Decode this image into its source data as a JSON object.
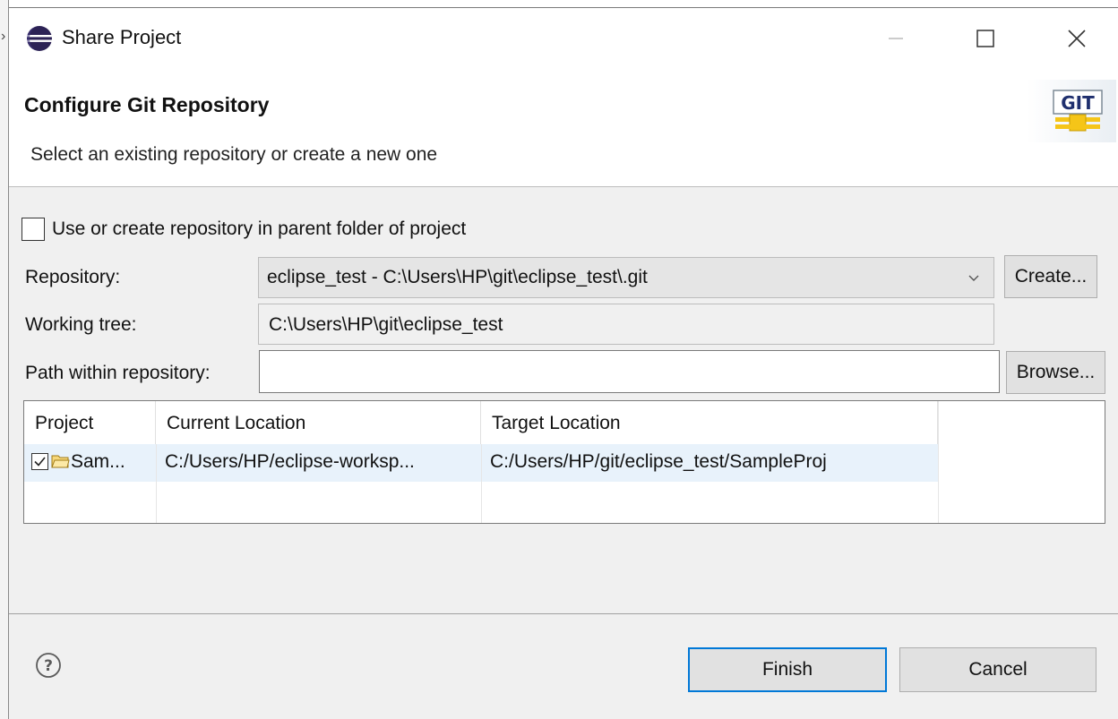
{
  "window": {
    "title": "Share Project"
  },
  "banner": {
    "title": "Configure Git Repository",
    "description": "Select an existing repository or create a new one",
    "logo_text": "GIT"
  },
  "form": {
    "parent_folder_label": "Use or create repository in parent folder of project",
    "parent_folder_checked": false,
    "repository_label": "Repository:",
    "repository_value": "eclipse_test - C:\\Users\\HP\\git\\eclipse_test\\.git",
    "create_label": "Create...",
    "working_tree_label": "Working tree:",
    "working_tree_value": "C:\\Users\\HP\\git\\eclipse_test",
    "path_label": "Path within repository:",
    "path_value": "",
    "browse_label": "Browse..."
  },
  "table": {
    "columns": [
      "Project",
      "Current Location",
      "Target Location"
    ],
    "rows": [
      {
        "checked": true,
        "project": "Sam...",
        "current_location": "C:/Users/HP/eclipse-worksp...",
        "target_location": "C:/Users/HP/git/eclipse_test/SampleProj"
      }
    ]
  },
  "footer": {
    "finish_label": "Finish",
    "cancel_label": "Cancel"
  },
  "colors": {
    "dialog_bg": "#f0f0f0",
    "banner_bg": "#ffffff",
    "row_selected": "#e8f2fb",
    "default_button_border": "#0078d7",
    "git_logo_yellow": "#f5c518"
  },
  "icons": [
    "eclipse-icon",
    "minimize-icon",
    "maximize-icon",
    "close-icon",
    "git-logo-icon",
    "chevron-down-icon",
    "checkbox-checked-icon",
    "folder-icon",
    "help-icon"
  ]
}
